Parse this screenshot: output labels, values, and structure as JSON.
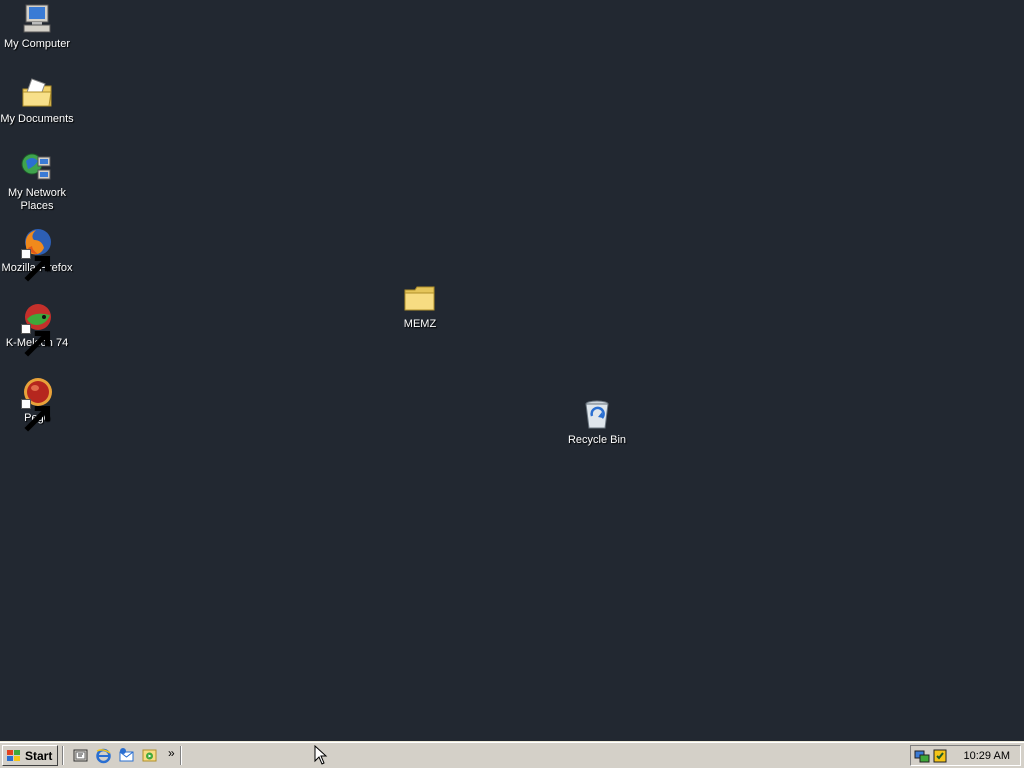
{
  "desktop": {
    "icons": [
      {
        "label": "My Computer",
        "icon": "my-computer-icon"
      },
      {
        "label": "My Documents",
        "icon": "my-documents-icon"
      },
      {
        "label": "My Network Places",
        "icon": "my-network-places-icon"
      },
      {
        "label": "Mozilla Firefox",
        "icon": "firefox-icon"
      },
      {
        "label": "K-Meleon 74",
        "icon": "k-meleon-icon"
      },
      {
        "label": "Pego",
        "icon": "pego-icon"
      },
      {
        "label": "MEMZ",
        "icon": "folder-icon"
      },
      {
        "label": "Recycle Bin",
        "icon": "recycle-bin-icon"
      }
    ],
    "background_color": "#222831"
  },
  "taskbar": {
    "start_label": "Start",
    "quick_launch": [
      "show-desktop-icon",
      "internet-explorer-icon",
      "outlook-express-icon",
      "windows-media-icon"
    ],
    "tray_icons": [
      "network-icon",
      "security-icon"
    ],
    "clock": "10:29 AM"
  }
}
